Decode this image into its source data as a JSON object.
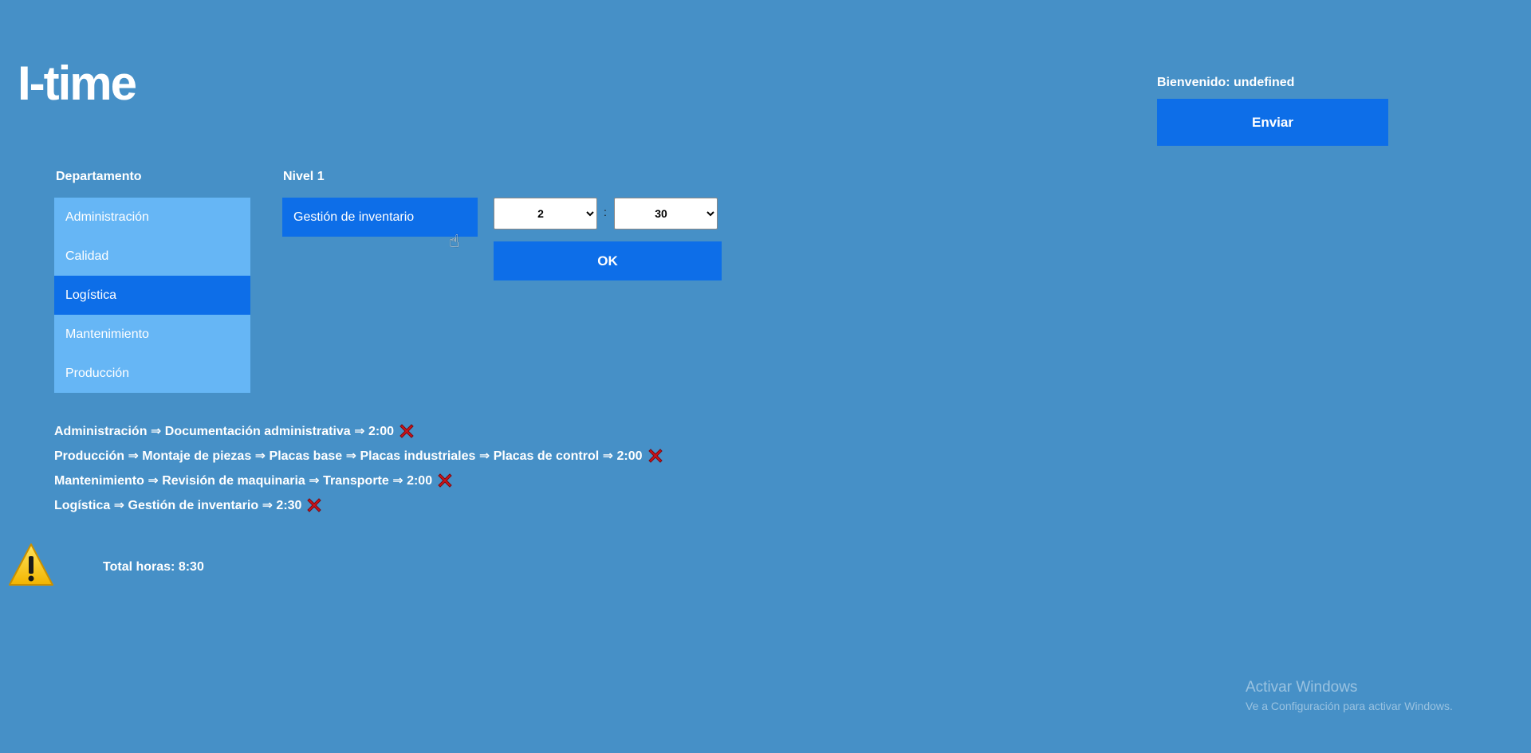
{
  "app": {
    "title": "I-time"
  },
  "header": {
    "welcome": "Bienvenido: undefined",
    "send_label": "Enviar"
  },
  "departments": {
    "label": "Departamento",
    "items": [
      {
        "label": "Administración",
        "selected": false
      },
      {
        "label": "Calidad",
        "selected": false
      },
      {
        "label": "Logística",
        "selected": true
      },
      {
        "label": "Mantenimiento",
        "selected": false
      },
      {
        "label": "Producción",
        "selected": false
      }
    ]
  },
  "level1": {
    "label": "Nivel 1",
    "items": [
      {
        "label": "Gestión de inventario",
        "selected": true
      }
    ]
  },
  "time": {
    "hours": "2",
    "separator": ":",
    "minutes": "30",
    "ok_label": "OK"
  },
  "entries": [
    "Administración ⇒ Documentación administrativa ⇒ 2:00",
    "Producción ⇒ Montaje de piezas ⇒ Placas base ⇒ Placas industriales ⇒ Placas de control ⇒ 2:00",
    "Mantenimiento ⇒ Revisión de maquinaria ⇒ Transporte ⇒ 2:00",
    "Logística ⇒ Gestión de inventario ⇒ 2:30"
  ],
  "total": {
    "text": "Total horas: 8:30"
  },
  "watermark": {
    "title": "Activar Windows",
    "subtitle": "Ve a Configuración para activar Windows."
  },
  "colors": {
    "background": "#4690c7",
    "accent": "#0d6ee8",
    "list_item": "#66b6f5",
    "delete": "#d0121b",
    "warning": "#f8c514"
  },
  "icons": {
    "delete": "close-x-icon",
    "warning": "warning-icon",
    "cursor": "hand-pointer-icon"
  }
}
